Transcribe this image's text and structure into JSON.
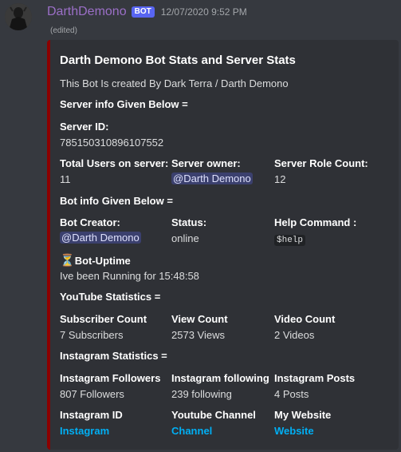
{
  "message": {
    "username": "DarthDemono",
    "bot_tag": "BOT",
    "timestamp": "12/07/2020 9:52 PM",
    "edited": "(edited)"
  },
  "embed": {
    "title": "Darth Demono Bot Stats and Server Stats",
    "description": "This Bot Is created By Dark Terra / Darth Demono",
    "server_info_heading": "Server info Given Below =",
    "server_id": {
      "name": "Server ID:",
      "value": "785150310896107552"
    },
    "total_users": {
      "name": "Total Users on server:",
      "value": "11"
    },
    "server_owner": {
      "name": "Server owner:",
      "value": "@Darth Demono"
    },
    "role_count": {
      "name": "Server Role Count:",
      "value": "12"
    },
    "bot_info_heading": "Bot info Given Below =",
    "bot_creator": {
      "name": "Bot Creator:",
      "value": "@Darth Demono"
    },
    "status": {
      "name": "Status:",
      "value": "online"
    },
    "help_command": {
      "name": "Help Command :",
      "value": "$help"
    },
    "uptime": {
      "icon": "⏳",
      "name": "Bot-Uptime",
      "value": "Ive been Running for 15:48:58"
    },
    "youtube_heading": "YouTube Statistics =",
    "subscriber_count": {
      "name": "Subscriber Count",
      "value": "7 Subscribers"
    },
    "view_count": {
      "name": "View Count",
      "value": "2573 Views"
    },
    "video_count": {
      "name": "Video Count",
      "value": "2 Videos"
    },
    "instagram_heading": "Instagram Statistics =",
    "ig_followers": {
      "name": "Instagram Followers",
      "value": "807 Followers"
    },
    "ig_following": {
      "name": "Instagram following",
      "value": "239 following"
    },
    "ig_posts": {
      "name": "Instagram Posts",
      "value": "4 Posts"
    },
    "ig_id": {
      "name": "Instagram ID",
      "value": "Instagram"
    },
    "yt_channel": {
      "name": "Youtube Channel",
      "value": "Channel"
    },
    "website": {
      "name": "My Website",
      "value": "Website"
    }
  },
  "colors": {
    "background": "#36393f",
    "embed_background": "#2f3136",
    "embed_accent": "#8b0000",
    "username": "#9b6fc7",
    "link": "#00aff4",
    "bot_tag": "#5865f2"
  }
}
